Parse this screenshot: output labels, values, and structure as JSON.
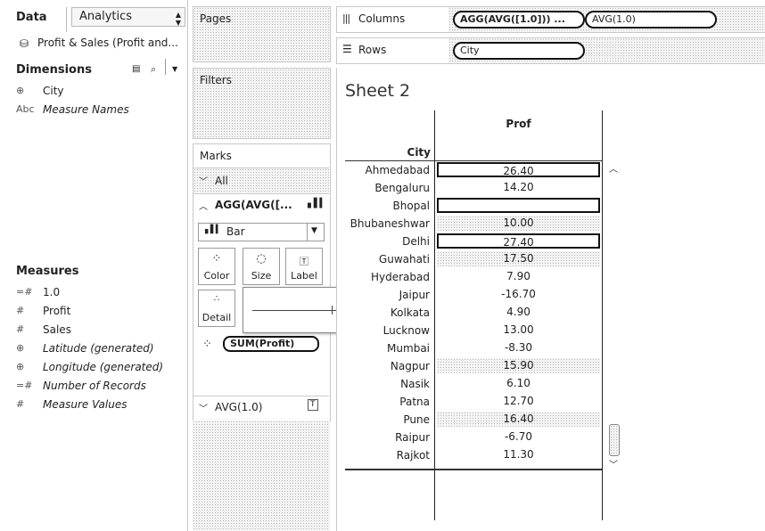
{
  "data_pane": {
    "tab_data": "Data",
    "tab_analytics": "Analytics",
    "datasource": "Profit & Sales (Profit and...",
    "dimensions_title": "Dimensions",
    "dimensions": [
      {
        "icon": "⊕",
        "name": "City",
        "italic": false
      },
      {
        "icon": "Abc",
        "name": "Measure Names",
        "italic": true
      }
    ],
    "measures_title": "Measures",
    "measures": [
      {
        "icon": "=#",
        "name": "1.0",
        "italic": false
      },
      {
        "icon": "#",
        "name": "Profit",
        "italic": false
      },
      {
        "icon": "#",
        "name": "Sales",
        "italic": false
      },
      {
        "icon": "⊕",
        "name": "Latitude (generated)",
        "italic": true
      },
      {
        "icon": "⊕",
        "name": "Longitude (generated)",
        "italic": true
      },
      {
        "icon": "=#",
        "name": "Number of Records",
        "italic": true
      },
      {
        "icon": "#",
        "name": "Measure Values",
        "italic": true
      }
    ]
  },
  "shelves": {
    "pages": "Pages",
    "filters": "Filters",
    "marks": "Marks",
    "all": "All",
    "agg_card": "AGG(AVG([...",
    "mark_type": "Bar",
    "color": "Color",
    "size": "Size",
    "label": "Label",
    "detail": "Detail",
    "profit_pill": "SUM(Profit)",
    "avg_card": "AVG(1.0)"
  },
  "columns": {
    "label": "Columns",
    "pills": [
      "AGG(AVG([1.0])) ...",
      "AVG(1.0)"
    ]
  },
  "rows": {
    "label": "Rows",
    "pills": [
      "City"
    ]
  },
  "view": {
    "sheet_title": "Sheet 2",
    "col_header": "Prof",
    "row_header": "City",
    "rows": [
      {
        "city": "Ahmedabad",
        "value": "26.40",
        "style": "outline"
      },
      {
        "city": "Bengaluru",
        "value": "14.20",
        "style": "plain"
      },
      {
        "city": "Bhopal",
        "value": "",
        "style": "outline"
      },
      {
        "city": "Bhubaneshwar",
        "value": "10.00",
        "style": "dotted"
      },
      {
        "city": "Delhi",
        "value": "27.40",
        "style": "outline"
      },
      {
        "city": "Guwahati",
        "value": "17.50",
        "style": "dotted"
      },
      {
        "city": "Hyderabad",
        "value": "7.90",
        "style": "plain"
      },
      {
        "city": "Jaipur",
        "value": "-16.70",
        "style": "plain"
      },
      {
        "city": "Kolkata",
        "value": "4.90",
        "style": "plain"
      },
      {
        "city": "Lucknow",
        "value": "13.00",
        "style": "plain"
      },
      {
        "city": "Mumbai",
        "value": "-8.30",
        "style": "plain"
      },
      {
        "city": "Nagpur",
        "value": "15.90",
        "style": "dotted"
      },
      {
        "city": "Nasik",
        "value": "6.10",
        "style": "plain"
      },
      {
        "city": "Patna",
        "value": "12.70",
        "style": "plain"
      },
      {
        "city": "Pune",
        "value": "16.40",
        "style": "dotted"
      },
      {
        "city": "Raipur",
        "value": "-6.70",
        "style": "plain"
      },
      {
        "city": "Rajkot",
        "value": "11.30",
        "style": "plain"
      }
    ]
  }
}
